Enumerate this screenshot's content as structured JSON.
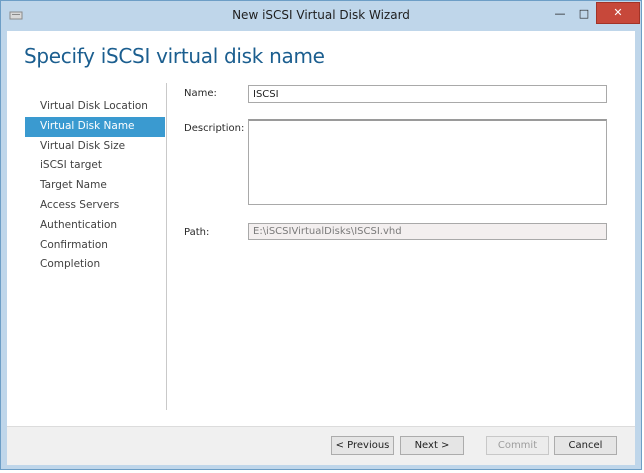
{
  "window": {
    "title": "New iSCSI Virtual Disk Wizard",
    "controls": {
      "minimize": "—",
      "maximize": "□",
      "close": "✕"
    }
  },
  "page": {
    "heading": "Specify iSCSI virtual disk name"
  },
  "nav": {
    "items": [
      {
        "label": "Virtual Disk Location",
        "active": false
      },
      {
        "label": "Virtual Disk Name",
        "active": true
      },
      {
        "label": "Virtual Disk Size",
        "active": false
      },
      {
        "label": "iSCSI target",
        "active": false
      },
      {
        "label": "Target Name",
        "active": false
      },
      {
        "label": "Access Servers",
        "active": false
      },
      {
        "label": "Authentication",
        "active": false
      },
      {
        "label": "Confirmation",
        "active": false
      },
      {
        "label": "Completion",
        "active": false
      }
    ]
  },
  "form": {
    "name_label": "Name:",
    "name_value": "ISCSI",
    "description_label": "Description:",
    "description_value": "",
    "path_label": "Path:",
    "path_value": "E:\\iSCSIVirtualDisks\\ISCSI.vhd"
  },
  "buttons": {
    "previous": "< Previous",
    "next": "Next >",
    "commit": "Commit",
    "cancel": "Cancel"
  },
  "colors": {
    "titlebar": "#bfd6ea",
    "heading": "#1b5e8f",
    "nav_active": "#3a9ad0",
    "close_button": "#c7483a"
  }
}
